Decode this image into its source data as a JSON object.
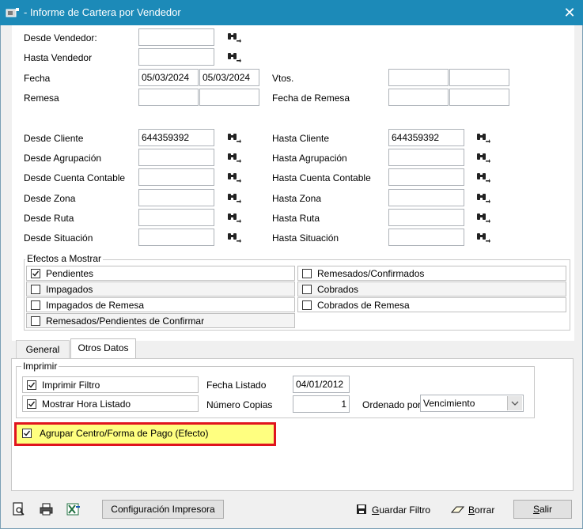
{
  "window": {
    "title": "- Informe de Cartera por Vendedor",
    "close_glyph": "✕"
  },
  "filters": {
    "desde_vendedor": {
      "label": "Desde Vendedor:",
      "value": ""
    },
    "hasta_vendedor": {
      "label": "Hasta Vendedor",
      "value": ""
    },
    "fecha": {
      "label": "Fecha",
      "from": "05/03/2024",
      "to": "05/03/2024"
    },
    "vtos": {
      "label": "Vtos.",
      "from": "",
      "to": ""
    },
    "remesa": {
      "label": "Remesa",
      "from": "",
      "to": ""
    },
    "fecha_remesa": {
      "label": "Fecha de Remesa",
      "from": "",
      "to": ""
    },
    "left": [
      {
        "label": "Desde Cliente",
        "value": "644359392"
      },
      {
        "label": "Desde Agrupación",
        "value": ""
      },
      {
        "label": "Desde Cuenta Contable",
        "value": ""
      },
      {
        "label": "Desde Zona",
        "value": ""
      },
      {
        "label": "Desde Ruta",
        "value": ""
      },
      {
        "label": "Desde Situación",
        "value": ""
      }
    ],
    "right": [
      {
        "label": "Hasta Cliente",
        "value": "644359392"
      },
      {
        "label": "Hasta Agrupación",
        "value": ""
      },
      {
        "label": "Hasta Cuenta Contable",
        "value": ""
      },
      {
        "label": "Hasta Zona",
        "value": ""
      },
      {
        "label": "Hasta Ruta",
        "value": ""
      },
      {
        "label": "Hasta Situación",
        "value": ""
      }
    ]
  },
  "efectos": {
    "title": "Efectos a Mostrar",
    "left": [
      {
        "label": "Pendientes",
        "checked": true
      },
      {
        "label": "Impagados",
        "checked": false
      },
      {
        "label": "Impagados de Remesa",
        "checked": false
      },
      {
        "label": "Remesados/Pendientes de Confirmar",
        "checked": false
      }
    ],
    "right": [
      {
        "label": "Remesados/Confirmados",
        "checked": false
      },
      {
        "label": "Cobrados",
        "checked": false
      },
      {
        "label": "Cobrados de Remesa",
        "checked": false
      }
    ]
  },
  "tabs": [
    {
      "label": "General",
      "active": false
    },
    {
      "label": "Otros Datos",
      "active": true
    }
  ],
  "imprimir": {
    "title": "Imprimir",
    "imprimir_filtro": {
      "label": "Imprimir Filtro",
      "checked": true
    },
    "mostrar_hora": {
      "label": "Mostrar Hora Listado",
      "checked": true
    },
    "fecha_listado": {
      "label": "Fecha Listado",
      "value": "04/01/2012"
    },
    "numero_copias": {
      "label": "Número Copias",
      "value": "1"
    },
    "ordenado_por": {
      "label": "Ordenado por",
      "value": "Vencimiento"
    }
  },
  "agrupar": {
    "label": "Agrupar Centro/Forma de Pago (Efecto)",
    "checked": true,
    "highlight": "#ffff80",
    "border": "#e0141e"
  },
  "toolbar": {
    "config_impresora": "Configuración Impresora",
    "guardar_filtro_prefix": "",
    "guardar_filtro_ul": "G",
    "guardar_filtro_rest": "uardar Filtro",
    "borrar_ul": "B",
    "borrar_rest": "orrar",
    "salir_ul": "S",
    "salir_rest": "alir"
  },
  "colors": {
    "titlebar": "#1c8ab8",
    "check": "#1a1a1a"
  }
}
